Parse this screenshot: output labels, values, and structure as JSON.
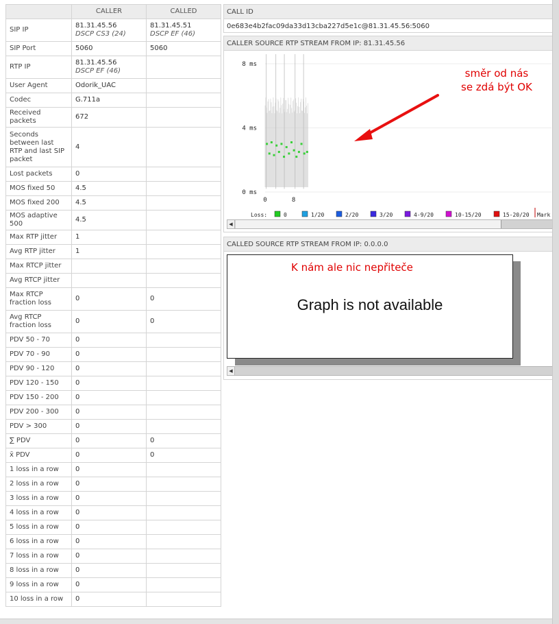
{
  "table": {
    "columns": [
      "",
      "CALLER",
      "CALLED"
    ],
    "rows": [
      {
        "label": "SIP IP",
        "caller": "81.31.45.56",
        "caller_sub": "DSCP CS3 (24)",
        "called": "81.31.45.51",
        "called_sub": "DSCP EF (46)"
      },
      {
        "label": "SIP Port",
        "caller": "5060",
        "caller_sub": "",
        "called": "5060",
        "called_sub": ""
      },
      {
        "label": "RTP IP",
        "caller": "81.31.45.56",
        "caller_sub": "DSCP EF (46)",
        "called": "",
        "called_sub": ""
      },
      {
        "label": "User Agent",
        "caller": "Odorik_UAC",
        "caller_sub": "",
        "called": "",
        "called_sub": ""
      },
      {
        "label": "Codec",
        "caller": "G.711a",
        "caller_sub": "",
        "called": "",
        "called_sub": ""
      },
      {
        "label": "Received packets",
        "caller": "672",
        "caller_sub": "",
        "called": "",
        "called_sub": ""
      },
      {
        "label": "Seconds between last RTP and last SIP packet",
        "caller": "4",
        "caller_sub": "",
        "called": "",
        "called_sub": ""
      },
      {
        "label": "Lost packets",
        "caller": "0",
        "caller_sub": "",
        "called": "",
        "called_sub": ""
      },
      {
        "label": "MOS fixed 50",
        "caller": "4.5",
        "caller_sub": "",
        "called": "",
        "called_sub": ""
      },
      {
        "label": "MOS fixed 200",
        "caller": "4.5",
        "caller_sub": "",
        "called": "",
        "called_sub": ""
      },
      {
        "label": "MOS adaptive 500",
        "caller": "4.5",
        "caller_sub": "",
        "called": "",
        "called_sub": ""
      },
      {
        "label": "Max RTP jitter",
        "caller": "1",
        "caller_sub": "",
        "called": "",
        "called_sub": ""
      },
      {
        "label": "Avg RTP jitter",
        "caller": "1",
        "caller_sub": "",
        "called": "",
        "called_sub": ""
      },
      {
        "label": "Max RTCP jitter",
        "caller": "",
        "caller_sub": "",
        "called": "",
        "called_sub": ""
      },
      {
        "label": "Avg RTCP jitter",
        "caller": "",
        "caller_sub": "",
        "called": "",
        "called_sub": ""
      },
      {
        "label": "Max RTCP fraction loss",
        "caller": "0",
        "caller_sub": "",
        "called": "0",
        "called_sub": ""
      },
      {
        "label": "Avg RTCP fraction loss",
        "caller": "0",
        "caller_sub": "",
        "called": "0",
        "called_sub": ""
      },
      {
        "label": "PDV 50 - 70",
        "caller": "0",
        "caller_sub": "",
        "called": "",
        "called_sub": ""
      },
      {
        "label": "PDV 70 - 90",
        "caller": "0",
        "caller_sub": "",
        "called": "",
        "called_sub": ""
      },
      {
        "label": "PDV 90 - 120",
        "caller": "0",
        "caller_sub": "",
        "called": "",
        "called_sub": ""
      },
      {
        "label": "PDV 120 - 150",
        "caller": "0",
        "caller_sub": "",
        "called": "",
        "called_sub": ""
      },
      {
        "label": "PDV 150 - 200",
        "caller": "0",
        "caller_sub": "",
        "called": "",
        "called_sub": ""
      },
      {
        "label": "PDV 200 - 300",
        "caller": "0",
        "caller_sub": "",
        "called": "",
        "called_sub": ""
      },
      {
        "label": "PDV > 300",
        "caller": "0",
        "caller_sub": "",
        "called": "",
        "called_sub": ""
      },
      {
        "label": "∑ PDV",
        "caller": "0",
        "caller_sub": "",
        "called": "0",
        "called_sub": ""
      },
      {
        "label": "x̄ PDV",
        "caller": "0",
        "caller_sub": "",
        "called": "0",
        "called_sub": ""
      },
      {
        "label": "1 loss in a row",
        "caller": "0",
        "caller_sub": "",
        "called": "",
        "called_sub": ""
      },
      {
        "label": "2 loss in a row",
        "caller": "0",
        "caller_sub": "",
        "called": "",
        "called_sub": ""
      },
      {
        "label": "3 loss in a row",
        "caller": "0",
        "caller_sub": "",
        "called": "",
        "called_sub": ""
      },
      {
        "label": "4 loss in a row",
        "caller": "0",
        "caller_sub": "",
        "called": "",
        "called_sub": ""
      },
      {
        "label": "5 loss in a row",
        "caller": "0",
        "caller_sub": "",
        "called": "",
        "called_sub": ""
      },
      {
        "label": "6 loss in a row",
        "caller": "0",
        "caller_sub": "",
        "called": "",
        "called_sub": ""
      },
      {
        "label": "7 loss in a row",
        "caller": "0",
        "caller_sub": "",
        "called": "",
        "called_sub": ""
      },
      {
        "label": "8 loss in a row",
        "caller": "0",
        "caller_sub": "",
        "called": "",
        "called_sub": ""
      },
      {
        "label": "9 loss in a row",
        "caller": "0",
        "caller_sub": "",
        "called": "",
        "called_sub": ""
      },
      {
        "label": "10 loss in a row",
        "caller": "0",
        "caller_sub": "",
        "called": "",
        "called_sub": ""
      }
    ]
  },
  "call_id": {
    "header": "CALL ID",
    "value": "0e683e4b2fac09da33d13cba227d5e1c@81.31.45.56:5060"
  },
  "caller_stream": {
    "header": "CALLER SOURCE RTP STREAM FROM IP: 81.31.45.56",
    "annotation": [
      "směr od nás",
      "se zdá být OK"
    ]
  },
  "called_stream": {
    "header": "CALLED SOURCE RTP STREAM FROM IP: 0.0.0.0",
    "annotation": "K nám ale nic nepřiteče",
    "not_available": "Graph is not available"
  },
  "chart_data": {
    "type": "scatter",
    "title": "",
    "xlabel": "",
    "ylabel": "",
    "y_ticks": [
      "8 ms",
      "4 ms",
      "0 ms"
    ],
    "x_ticks": [
      "0",
      "8"
    ],
    "ylim": [
      0,
      8
    ],
    "grid": true,
    "series": [
      {
        "x": [
          0.5,
          1.2,
          1.8,
          2.5,
          3.2,
          3.9,
          4.6,
          5.3,
          6.0,
          6.7,
          7.4,
          8.1,
          8.8,
          9.5,
          10.2,
          11.0,
          11.8
        ],
        "y": [
          3.0,
          2.4,
          3.1,
          2.3,
          2.9,
          2.5,
          3.0,
          2.2,
          2.8,
          2.4,
          3.1,
          2.6,
          2.2,
          2.5,
          3.0,
          2.4,
          2.5
        ]
      }
    ],
    "legend_prefix": "Loss:",
    "legend": [
      {
        "label": "0",
        "color": "#22cc22"
      },
      {
        "label": "1/20",
        "color": "#20a0e0"
      },
      {
        "label": "2/20",
        "color": "#1c5de0"
      },
      {
        "label": "3/20",
        "color": "#3a2ae0"
      },
      {
        "label": "4-9/20",
        "color": "#7a1ae0"
      },
      {
        "label": "10-15/20",
        "color": "#d010d0"
      },
      {
        "label": "15-20/20",
        "color": "#e01010"
      },
      {
        "label": "Mark",
        "color": "#c00000"
      }
    ],
    "colors": {
      "points": "#3ad03a",
      "band": "#c8c8c8",
      "annotation": "#e00000"
    }
  }
}
